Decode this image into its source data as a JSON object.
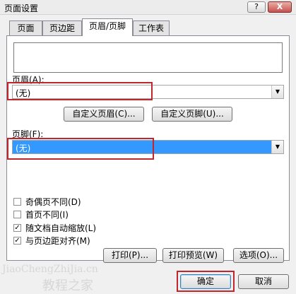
{
  "window": {
    "title": "页面设置",
    "help_label": "?",
    "close_label": "X"
  },
  "tabs": [
    {
      "label": "页面",
      "active": false
    },
    {
      "label": "页边距",
      "active": false
    },
    {
      "label": "页眉/页脚",
      "active": true
    },
    {
      "label": "工作表",
      "active": false
    }
  ],
  "header": {
    "label": "页眉(A):",
    "value": "(无)"
  },
  "custom_buttons": {
    "custom_header": "自定义页眉(C)...",
    "custom_footer": "自定义页脚(U)..."
  },
  "footer": {
    "label": "页脚(F):",
    "value": "(无)"
  },
  "options": [
    {
      "label": "奇偶页不同(D)",
      "checked": false
    },
    {
      "label": "首页不同(I)",
      "checked": false
    },
    {
      "label": "随文档自动缩放(L)",
      "checked": true
    },
    {
      "label": "与页边距对齐(M)",
      "checked": true
    }
  ],
  "action_buttons": {
    "print": "打印(P)...",
    "print_preview": "打印预览(W)",
    "options": "选项(O)..."
  },
  "dialog_buttons": {
    "ok": "确定",
    "cancel": "取消"
  },
  "watermark": {
    "line1": "JiaoChengZhiJia.cn",
    "line2": "教程之家"
  },
  "icons": {
    "dropdown": "chevron-down-icon",
    "check": "checkmark-icon"
  },
  "colors": {
    "highlight_box": "#c0262c",
    "selection": "#3399ff"
  }
}
